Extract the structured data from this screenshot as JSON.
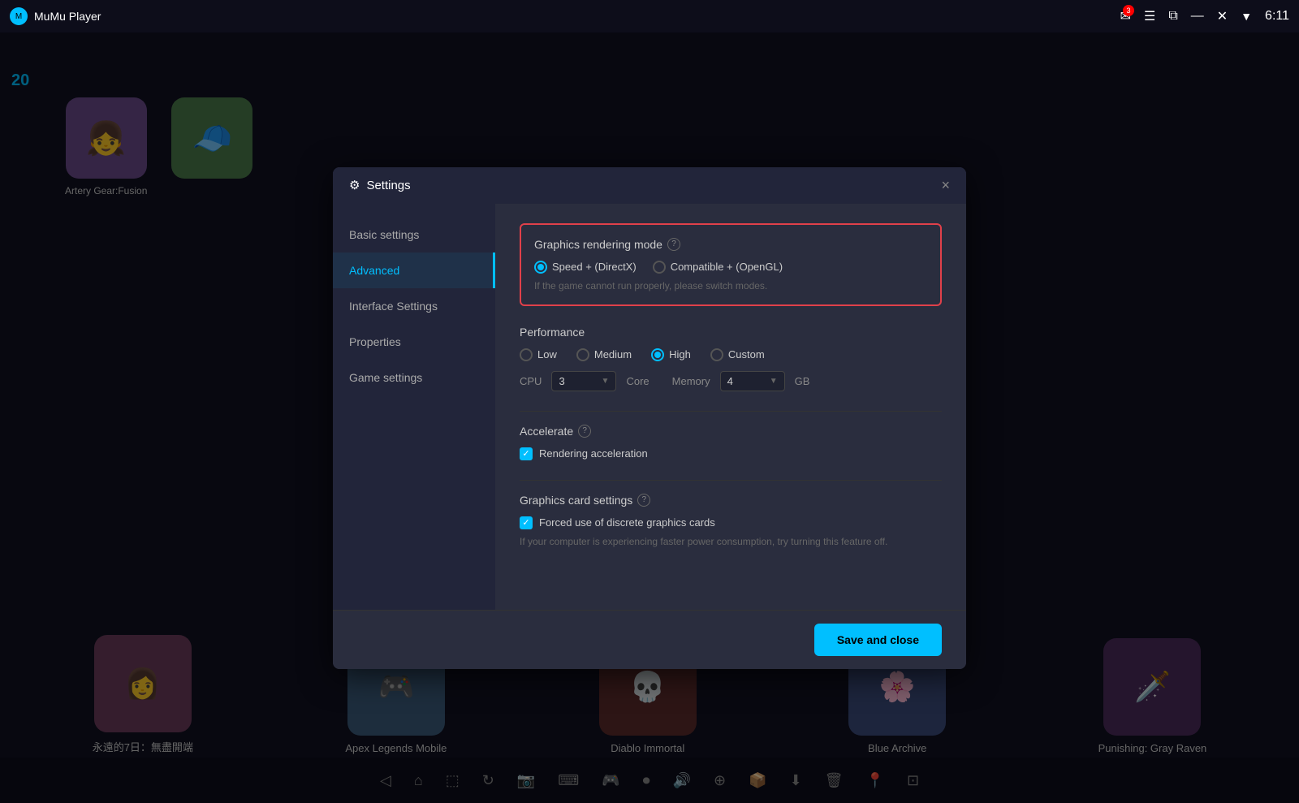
{
  "app": {
    "title": "MuMu Player",
    "level": "20",
    "time": "6:11",
    "mail_badge": "3"
  },
  "settings_dialog": {
    "title": "Settings",
    "close_btn": "×",
    "nav": {
      "items": [
        {
          "id": "basic",
          "label": "Basic settings",
          "active": false
        },
        {
          "id": "advanced",
          "label": "Advanced",
          "active": true
        },
        {
          "id": "interface",
          "label": "Interface Settings",
          "active": false
        },
        {
          "id": "properties",
          "label": "Properties",
          "active": false
        },
        {
          "id": "game",
          "label": "Game settings",
          "active": false
        }
      ]
    },
    "graphics_rendering": {
      "title": "Graphics rendering mode",
      "options": [
        {
          "id": "speed",
          "label": "Speed + (DirectX)",
          "selected": true
        },
        {
          "id": "compatible",
          "label": "Compatible + (OpenGL)",
          "selected": false
        }
      ],
      "hint": "If the game cannot run properly, please switch modes."
    },
    "performance": {
      "title": "Performance",
      "options": [
        {
          "id": "low",
          "label": "Low",
          "selected": false
        },
        {
          "id": "medium",
          "label": "Medium",
          "selected": false
        },
        {
          "id": "high",
          "label": "High",
          "selected": true
        },
        {
          "id": "custom",
          "label": "Custom",
          "selected": false
        }
      ],
      "cpu_label": "CPU",
      "cpu_value": "3",
      "cpu_unit": "Core",
      "memory_label": "Memory",
      "memory_value": "4",
      "memory_unit": "GB"
    },
    "accelerate": {
      "title": "Accelerate",
      "rendering_acceleration_label": "Rendering acceleration",
      "rendering_acceleration_checked": true
    },
    "graphics_card": {
      "title": "Graphics card settings",
      "discrete_gpu_label": "Forced use of discrete graphics cards",
      "discrete_gpu_checked": true,
      "hint": "If your computer is experiencing faster power consumption, try turning this feature off."
    },
    "footer": {
      "save_button": "Save and close"
    }
  },
  "games": {
    "top": [
      {
        "label": "Artery Gear:Fusion",
        "color": "#6a4a8a",
        "emoji": "👧"
      },
      {
        "label": "",
        "color": "#4a7a4a",
        "emoji": "🧢"
      }
    ],
    "bottom": [
      {
        "label": "永遠的7日：無盡開端",
        "color": "#6a3a5a",
        "emoji": "👩"
      },
      {
        "label": "Apex Legends Mobile",
        "color": "#3a5a7a",
        "emoji": "🎮"
      },
      {
        "label": "Diablo Immortal",
        "color": "#5a2a2a",
        "emoji": "💀"
      },
      {
        "label": "Blue Archive",
        "color": "#3a4a7a",
        "emoji": "🌸"
      },
      {
        "label": "Punishing: Gray Raven",
        "color": "#4a2a5a",
        "emoji": "🗡️"
      }
    ]
  },
  "bottom_bar": {
    "icons": [
      "◁",
      "⌂",
      "⬚",
      "🔄",
      "📷",
      "⌨",
      "🎮",
      "⏺",
      "🔊",
      "⊕",
      "📦",
      "⬇",
      "🗑",
      "📍",
      "⊡"
    ]
  }
}
